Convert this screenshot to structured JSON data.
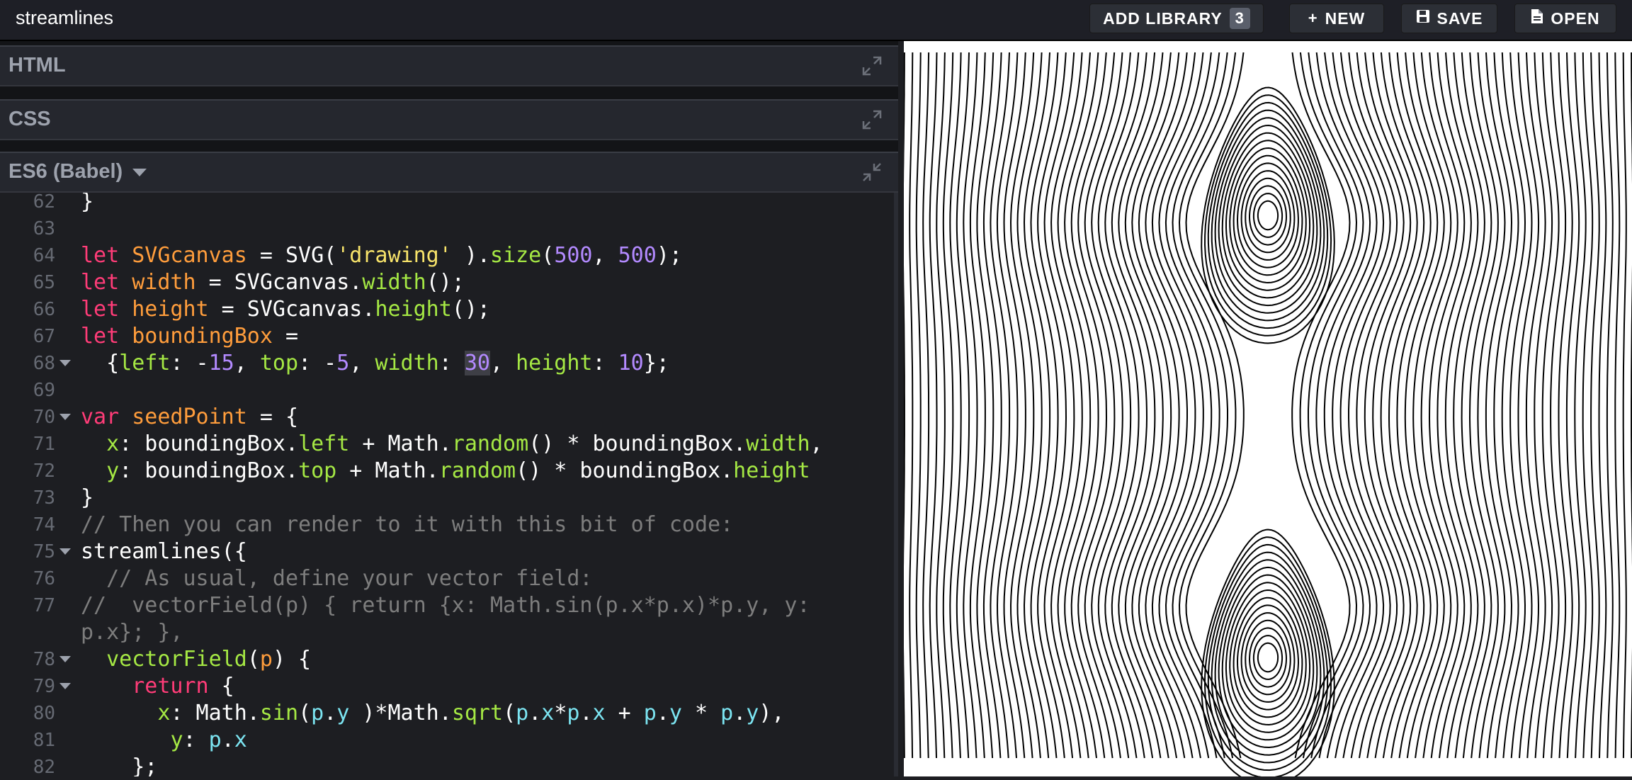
{
  "app": {
    "title": "streamlines"
  },
  "toolbar": {
    "add_library_label": "ADD LIBRARY",
    "add_library_count": "3",
    "new_label": "NEW",
    "save_label": "SAVE",
    "open_label": "OPEN"
  },
  "panels": {
    "html_label": "HTML",
    "css_label": "CSS",
    "js_label": "ES6 (Babel)"
  },
  "code": {
    "lines": [
      {
        "n": "62",
        "fold": false,
        "segs": [
          [
            "",
            "}"
          ]
        ]
      },
      {
        "n": "63",
        "fold": false,
        "segs": []
      },
      {
        "n": "64",
        "fold": false,
        "segs": [
          [
            "kw",
            "let "
          ],
          [
            "var",
            "SVGcanvas"
          ],
          [
            "",
            " = SVG("
          ],
          [
            "str",
            "'drawing'"
          ],
          [
            "",
            " )."
          ],
          [
            "fn",
            "size"
          ],
          [
            "",
            "("
          ],
          [
            "num",
            "500"
          ],
          [
            "",
            ", "
          ],
          [
            "num",
            "500"
          ],
          [
            "",
            ");"
          ]
        ]
      },
      {
        "n": "65",
        "fold": false,
        "segs": [
          [
            "kw",
            "let "
          ],
          [
            "var",
            "width"
          ],
          [
            "",
            " = SVGcanvas."
          ],
          [
            "fn",
            "width"
          ],
          [
            "",
            "();"
          ]
        ]
      },
      {
        "n": "66",
        "fold": false,
        "segs": [
          [
            "kw",
            "let "
          ],
          [
            "var",
            "height"
          ],
          [
            "",
            " = SVGcanvas."
          ],
          [
            "fn",
            "height"
          ],
          [
            "",
            "();"
          ]
        ]
      },
      {
        "n": "67",
        "fold": false,
        "segs": [
          [
            "kw",
            "let "
          ],
          [
            "var",
            "boundingBox"
          ],
          [
            "",
            " ="
          ]
        ]
      },
      {
        "n": "68",
        "fold": true,
        "segs": [
          [
            "",
            "  {"
          ],
          [
            "prop",
            "left"
          ],
          [
            "",
            ": -"
          ],
          [
            "num",
            "15"
          ],
          [
            "",
            ", "
          ],
          [
            "prop",
            "top"
          ],
          [
            "",
            ": -"
          ],
          [
            "num",
            "5"
          ],
          [
            "",
            ", "
          ],
          [
            "prop",
            "width"
          ],
          [
            "",
            ": "
          ],
          [
            "sel",
            "30"
          ],
          [
            "",
            ", "
          ],
          [
            "prop",
            "height"
          ],
          [
            "",
            ": "
          ],
          [
            "num",
            "10"
          ],
          [
            "",
            "};"
          ]
        ]
      },
      {
        "n": "69",
        "fold": false,
        "segs": []
      },
      {
        "n": "70",
        "fold": true,
        "segs": [
          [
            "kw",
            "var "
          ],
          [
            "var",
            "seedPoint"
          ],
          [
            "",
            " = {"
          ]
        ]
      },
      {
        "n": "71",
        "fold": false,
        "segs": [
          [
            "",
            "  "
          ],
          [
            "prop",
            "x"
          ],
          [
            "",
            ": boundingBox."
          ],
          [
            "prop",
            "left"
          ],
          [
            "",
            " + Math."
          ],
          [
            "fn",
            "random"
          ],
          [
            "",
            "() * boundingBox."
          ],
          [
            "prop",
            "width"
          ],
          [
            "",
            ","
          ]
        ]
      },
      {
        "n": "72",
        "fold": false,
        "segs": [
          [
            "",
            "  "
          ],
          [
            "prop",
            "y"
          ],
          [
            "",
            ": boundingBox."
          ],
          [
            "prop",
            "top"
          ],
          [
            "",
            " + Math."
          ],
          [
            "fn",
            "random"
          ],
          [
            "",
            "() * boundingBox."
          ],
          [
            "prop",
            "height"
          ]
        ]
      },
      {
        "n": "73",
        "fold": false,
        "segs": [
          [
            "",
            "}"
          ]
        ]
      },
      {
        "n": "74",
        "fold": false,
        "segs": [
          [
            "cmt",
            "// Then you can render to it with this bit of code:"
          ]
        ]
      },
      {
        "n": "75",
        "fold": true,
        "segs": [
          [
            "",
            "streamlines({"
          ]
        ]
      },
      {
        "n": "76",
        "fold": false,
        "segs": [
          [
            "cmt",
            "  // As usual, define your vector field:"
          ]
        ]
      },
      {
        "n": "77",
        "fold": false,
        "segs": [
          [
            "cmt",
            "//  vectorField(p) { return {x: Math.sin(p.x*p.x)*p.y, y:"
          ]
        ]
      },
      {
        "n": "",
        "fold": false,
        "segs": [
          [
            "cmt",
            "p.x}; },"
          ]
        ]
      },
      {
        "n": "78",
        "fold": true,
        "segs": [
          [
            "",
            "  "
          ],
          [
            "fn",
            "vectorField"
          ],
          [
            "",
            "("
          ],
          [
            "var",
            "p"
          ],
          [
            "",
            ") {"
          ]
        ]
      },
      {
        "n": "79",
        "fold": true,
        "segs": [
          [
            "",
            "    "
          ],
          [
            "kw",
            "return"
          ],
          [
            "",
            " {"
          ]
        ]
      },
      {
        "n": "80",
        "fold": false,
        "segs": [
          [
            "",
            "      "
          ],
          [
            "prop",
            "x"
          ],
          [
            "",
            ": Math."
          ],
          [
            "fn",
            "sin"
          ],
          [
            "",
            "("
          ],
          [
            "p",
            "p"
          ],
          [
            "",
            "."
          ],
          [
            "p",
            "y"
          ],
          [
            "",
            " )*Math."
          ],
          [
            "fn",
            "sqrt"
          ],
          [
            "",
            "("
          ],
          [
            "p",
            "p"
          ],
          [
            "",
            "."
          ],
          [
            "p",
            "x"
          ],
          [
            "",
            "*"
          ],
          [
            "p",
            "p"
          ],
          [
            "",
            "."
          ],
          [
            "p",
            "x"
          ],
          [
            "",
            " + "
          ],
          [
            "p",
            "p"
          ],
          [
            "",
            "."
          ],
          [
            "p",
            "y"
          ],
          [
            "",
            " * "
          ],
          [
            "p",
            "p"
          ],
          [
            "",
            "."
          ],
          [
            "p",
            "y"
          ],
          [
            "",
            "),"
          ]
        ]
      },
      {
        "n": "81",
        "fold": false,
        "segs": [
          [
            "",
            "       "
          ],
          [
            "prop",
            "y"
          ],
          [
            "",
            ": "
          ],
          [
            "p",
            "p"
          ],
          [
            "",
            "."
          ],
          [
            "p",
            "x"
          ]
        ]
      },
      {
        "n": "82",
        "fold": false,
        "segs": [
          [
            "",
            "    };"
          ]
        ]
      }
    ]
  }
}
